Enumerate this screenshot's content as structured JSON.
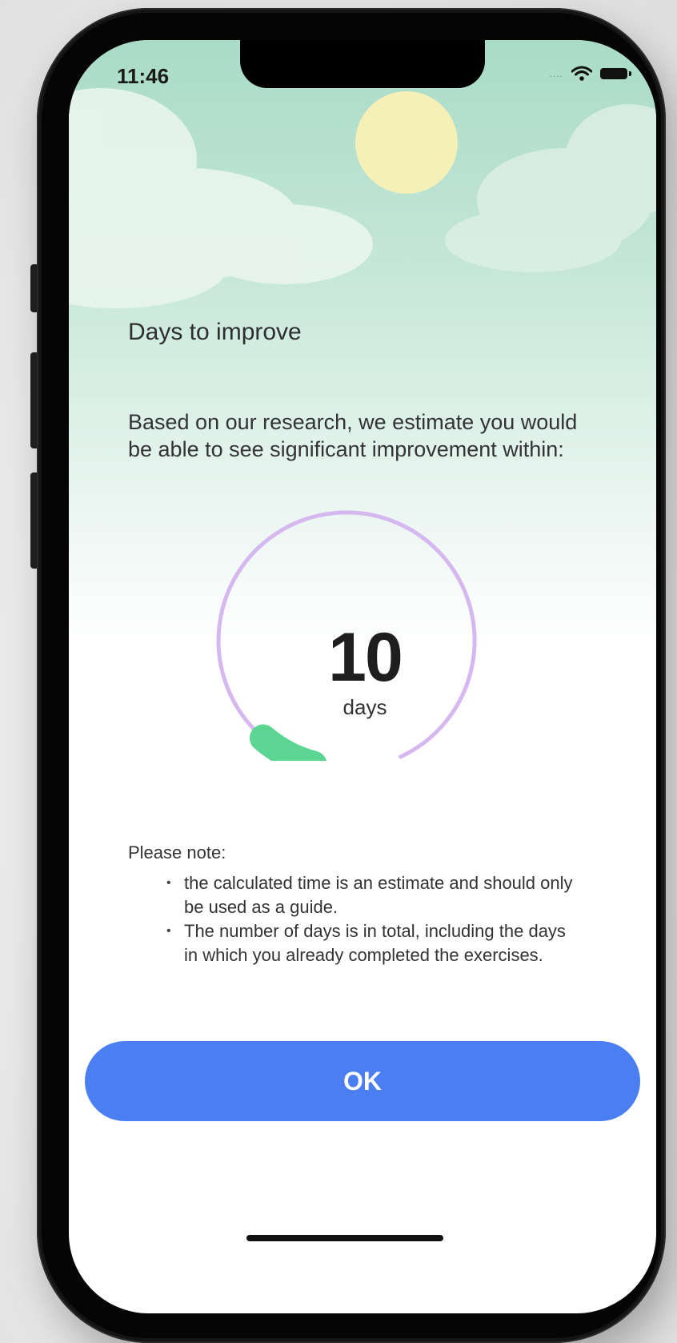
{
  "status_bar": {
    "time": "11:46"
  },
  "screen": {
    "title": "Days to improve",
    "description": "Based on our research, we estimate you would be able to see significant improvement within:",
    "gauge": {
      "value": "10",
      "unit": "days",
      "progress_fraction": 0.08
    },
    "note_label": "Please note:",
    "notes": [
      "the calculated time is an estimate and should only be used as a guide.",
      "The number of days is in total, including the days in which you already completed the exercises."
    ],
    "ok_label": "OK"
  },
  "colors": {
    "sky": "#a9dcc7",
    "gauge_track": "#d5b8ef",
    "gauge_progress": "#5ed693",
    "button": "#4b7ef0",
    "sun": "#f5efb8"
  },
  "icons": [
    "signal-dots-icon",
    "wifi-icon",
    "battery-icon",
    "sun-icon",
    "cloud-icon"
  ]
}
